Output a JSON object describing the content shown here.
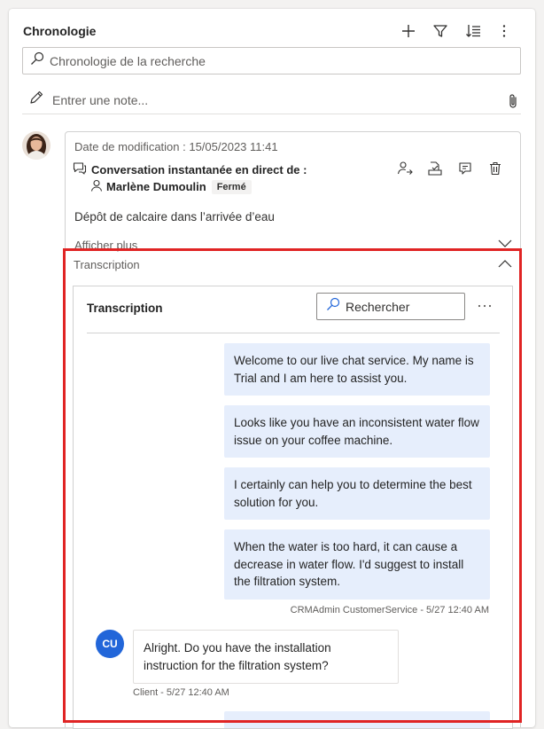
{
  "header": {
    "title": "Chronologie"
  },
  "search": {
    "placeholder": "Chronologie de la recherche"
  },
  "note": {
    "placeholder": "Entrer une note..."
  },
  "activity": {
    "modified": "Date de modification : 15/05/2023 11:41",
    "type_label": "Conversation instantanée en direct de :",
    "person": "Marlène Dumoulin",
    "status": "Fermé",
    "subject": "Dépôt de calcaire dans l’arrivée d’eau",
    "show_more": "Afficher plus",
    "transcription_label": "Transcription"
  },
  "transcript": {
    "title": "Transcription",
    "search_placeholder": "Rechercher",
    "agent_messages": [
      "Welcome to our live chat service. My name is Trial and I am here to assist you.",
      "Looks like you have an inconsistent water flow issue on your coffee machine.",
      "I certainly can help you to determine the best solution for you.",
      "When the water is too hard, it can cause a decrease in water flow. I'd suggest to install the filtration system."
    ],
    "agent_meta": "CRMAdmin CustomerService - 5/27 12:40 AM",
    "client_initials": "CU",
    "client_message": "Alright. Do you have the installation instruction for the filtration system?",
    "client_meta": "Client - 5/27 12:40 AM"
  },
  "icons": {
    "add": "add-icon",
    "filter": "filter-icon",
    "sort": "sort-icon",
    "more": "more-vertical-icon",
    "search": "search-icon",
    "pencil": "pencil-icon",
    "attach": "paperclip-icon"
  },
  "colors": {
    "accent": "#2266d9",
    "highlight": "#e02424",
    "bubble": "#e6eefc"
  }
}
